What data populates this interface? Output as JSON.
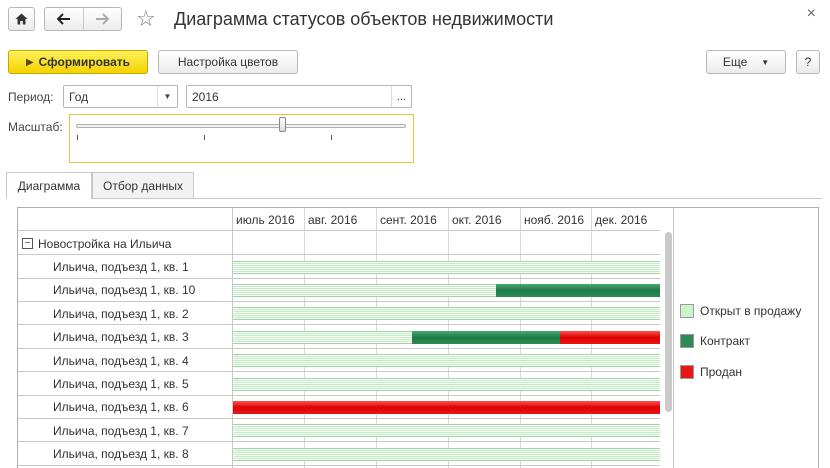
{
  "window": {
    "title": "Диаграмма статусов объектов недвижимости",
    "home_icon": "home-icon",
    "back_icon": "arrow-left-icon",
    "forward_icon": "arrow-right-icon",
    "favorite_icon": "star-icon",
    "close_icon": "close-icon"
  },
  "toolbar": {
    "generate_label": "Сформировать",
    "colors_label": "Настройка цветов",
    "more_label": "Еще",
    "help_label": "?"
  },
  "filters": {
    "period_label": "Период:",
    "period_value": "Год",
    "year_value": "2016",
    "choose_label": "...",
    "scale_label": "Масштаб:",
    "scale_level": 0.62
  },
  "tabs": [
    {
      "label": "Диаграмма",
      "active": true
    },
    {
      "label": "Отбор данных",
      "active": false
    }
  ],
  "gantt": {
    "months": [
      "июль 2016",
      "авг. 2016",
      "сент. 2016",
      "окт. 2016",
      "нояб. 2016",
      "дек. 2016"
    ],
    "group": "Новостройка на Ильича",
    "collapse_symbol": "−",
    "rows": [
      {
        "label": "Ильича, подъезд 1, кв. 1",
        "segments": [
          {
            "status": "open",
            "start": 0.0,
            "end": 6.0
          }
        ]
      },
      {
        "label": "Ильича, подъезд 1, кв. 10",
        "segments": [
          {
            "status": "open",
            "start": 0.0,
            "end": 3.7
          },
          {
            "status": "contract",
            "start": 3.7,
            "end": 6.0
          }
        ]
      },
      {
        "label": "Ильича, подъезд 1, кв. 2",
        "segments": [
          {
            "status": "open",
            "start": 0.0,
            "end": 6.0
          }
        ]
      },
      {
        "label": "Ильича, подъезд 1, кв. 3",
        "segments": [
          {
            "status": "open",
            "start": 0.0,
            "end": 2.52
          },
          {
            "status": "contract",
            "start": 2.52,
            "end": 4.6
          },
          {
            "status": "sold",
            "start": 4.6,
            "end": 6.0
          }
        ]
      },
      {
        "label": "Ильича, подъезд 1, кв. 4",
        "segments": [
          {
            "status": "open",
            "start": 0.0,
            "end": 6.0
          }
        ]
      },
      {
        "label": "Ильича, подъезд 1, кв. 5",
        "segments": [
          {
            "status": "open",
            "start": 0.0,
            "end": 6.0
          }
        ]
      },
      {
        "label": "Ильича, подъезд 1, кв. 6",
        "segments": [
          {
            "status": "sold",
            "start": 0.0,
            "end": 6.0
          }
        ]
      },
      {
        "label": "Ильича, подъезд 1, кв. 7",
        "segments": [
          {
            "status": "open",
            "start": 0.0,
            "end": 6.0
          }
        ]
      },
      {
        "label": "Ильича, подъезд 1, кв. 8",
        "segments": [
          {
            "status": "open",
            "start": 0.0,
            "end": 6.0
          }
        ]
      }
    ]
  },
  "legend": [
    {
      "key": "open",
      "label": "Открыт в продажу",
      "color": "#ccf5cc"
    },
    {
      "key": "contract",
      "label": "Контракт",
      "color": "#2e8b57"
    },
    {
      "key": "sold",
      "label": "Продан",
      "color": "#e81616"
    }
  ]
}
